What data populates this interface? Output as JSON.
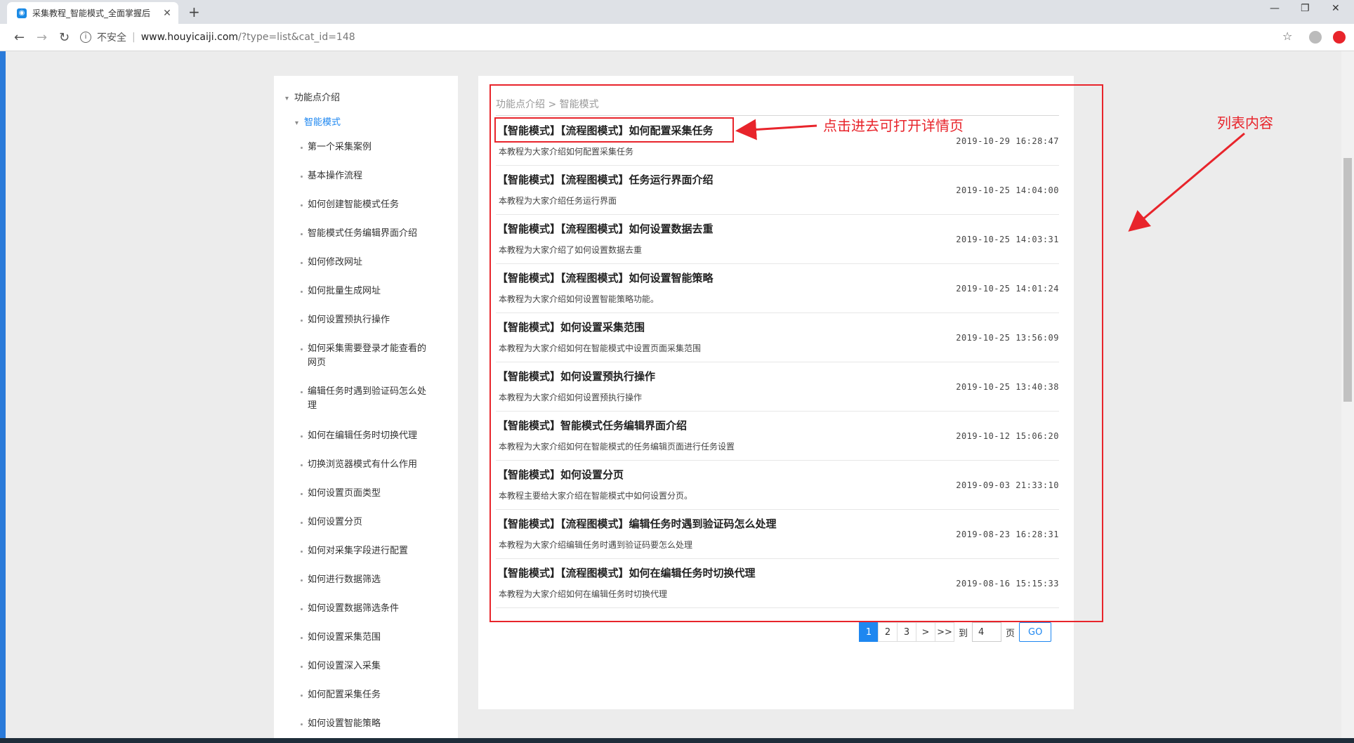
{
  "browser": {
    "tab_title": "采集教程_智能模式_全面掌握后",
    "url_host": "www.houyicaiji.com",
    "url_path": "/?type=list&cat_id=148",
    "security_label": "不安全",
    "separator": "|"
  },
  "sidebar": {
    "root_label": "功能点介绍",
    "sub_label": "智能模式",
    "items": [
      "第一个采集案例",
      "基本操作流程",
      "如何创建智能模式任务",
      "智能模式任务编辑界面介绍",
      "如何修改网址",
      "如何批量生成网址",
      "如何设置预执行操作",
      "如何采集需要登录才能查看的网页",
      "编辑任务时遇到验证码怎么处理",
      "如何在编辑任务时切换代理",
      "切换浏览器模式有什么作用",
      "如何设置页面类型",
      "如何设置分页",
      "如何对采集字段进行配置",
      "如何进行数据筛选",
      "如何设置数据筛选条件",
      "如何设置采集范围",
      "如何设置深入采集",
      "如何配置采集任务",
      "如何设置智能策略"
    ]
  },
  "breadcrumb": "功能点介绍 > 智能模式",
  "articles": [
    {
      "title": "【智能模式】【流程图模式】如何配置采集任务",
      "desc": "本教程为大家介绍如何配置采集任务",
      "time": "2019-10-29 16:28:47"
    },
    {
      "title": "【智能模式】【流程图模式】任务运行界面介绍",
      "desc": "本教程为大家介绍任务运行界面",
      "time": "2019-10-25 14:04:00"
    },
    {
      "title": "【智能模式】【流程图模式】如何设置数据去重",
      "desc": "本教程为大家介绍了如何设置数据去重",
      "time": "2019-10-25 14:03:31"
    },
    {
      "title": "【智能模式】【流程图模式】如何设置智能策略",
      "desc": "本教程为大家介绍如何设置智能策略功能。",
      "time": "2019-10-25 14:01:24"
    },
    {
      "title": "【智能模式】如何设置采集范围",
      "desc": "本教程为大家介绍如何在智能模式中设置页面采集范围",
      "time": "2019-10-25 13:56:09"
    },
    {
      "title": "【智能模式】如何设置预执行操作",
      "desc": "本教程为大家介绍如何设置预执行操作",
      "time": "2019-10-25 13:40:38"
    },
    {
      "title": "【智能模式】智能模式任务编辑界面介绍",
      "desc": "本教程为大家介绍如何在智能模式的任务编辑页面进行任务设置",
      "time": "2019-10-12 15:06:20"
    },
    {
      "title": "【智能模式】如何设置分页",
      "desc": "本教程主要给大家介绍在智能模式中如何设置分页。",
      "time": "2019-09-03 21:33:10"
    },
    {
      "title": "【智能模式】【流程图模式】编辑任务时遇到验证码怎么处理",
      "desc": "本教程为大家介绍编辑任务时遇到验证码要怎么处理",
      "time": "2019-08-23 16:28:31"
    },
    {
      "title": "【智能模式】【流程图模式】如何在编辑任务时切换代理",
      "desc": "本教程为大家介绍如何在编辑任务时切换代理",
      "time": "2019-08-16 15:15:33"
    }
  ],
  "pagination": {
    "pages": [
      "1",
      "2",
      "3"
    ],
    "next": ">",
    "last": ">>",
    "goto_label": "到",
    "page_input": "4",
    "page_suffix": "页",
    "go_label": "GO"
  },
  "annotations": {
    "click_hint": "点击进去可打开详情页",
    "list_label": "列表内容",
    "color": "#e8242b"
  }
}
